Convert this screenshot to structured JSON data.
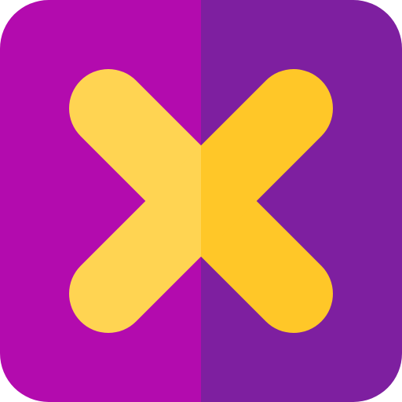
{
  "icon": {
    "name": "close-icon",
    "colors": {
      "tile_left": "#B30BAE",
      "tile_right": "#7E1FA0",
      "cross_left": "#FFD452",
      "cross_right": "#FFC728"
    }
  }
}
